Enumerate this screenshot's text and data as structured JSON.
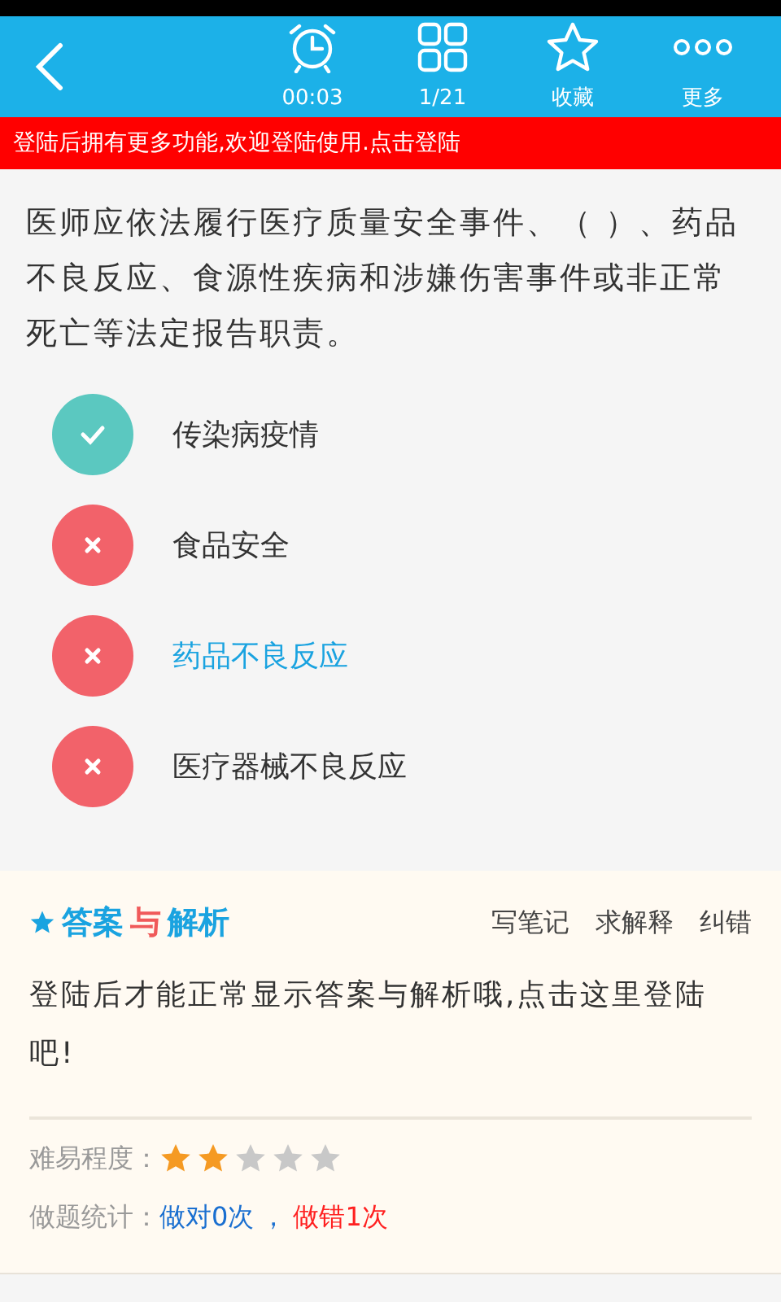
{
  "toolbar": {
    "items": [
      {
        "kind": "clock",
        "label": "00:03"
      },
      {
        "kind": "grid",
        "label": "1/21"
      },
      {
        "kind": "star",
        "label": "收藏"
      },
      {
        "kind": "more",
        "label": "更多"
      }
    ]
  },
  "login_banner": "登陆后拥有更多功能,欢迎登陆使用.点击登陆",
  "question": "医师应依法履行医疗质量安全事件、（  ）、药品不良反应、食源性疾病和涉嫌伤害事件或非正常死亡等法定报告职责。",
  "options": [
    {
      "text": "传染病疫情",
      "kind": "correct",
      "selected": false
    },
    {
      "text": "食品安全",
      "kind": "wrong",
      "selected": false
    },
    {
      "text": "药品不良反应",
      "kind": "wrong",
      "selected": true
    },
    {
      "text": "医疗器械不良反应",
      "kind": "wrong",
      "selected": false
    }
  ],
  "analysis": {
    "logo": [
      {
        "text": "答案",
        "color": "#1aa3e0"
      },
      {
        "text": "与",
        "color": "#f05a5a"
      },
      {
        "text": "解析",
        "color": "#1aa3e0"
      }
    ],
    "actions": [
      "写笔记",
      "求解释",
      "纠错"
    ],
    "message": "登陆后才能正常显示答案与解析哦,点击这里登陆吧!",
    "difficulty_label": "难易程度：",
    "stars": 2,
    "stats_label": "做题统计：",
    "stats_correct": "做对0次",
    "stats_separator": "，",
    "stats_wrong": "做错1次"
  }
}
